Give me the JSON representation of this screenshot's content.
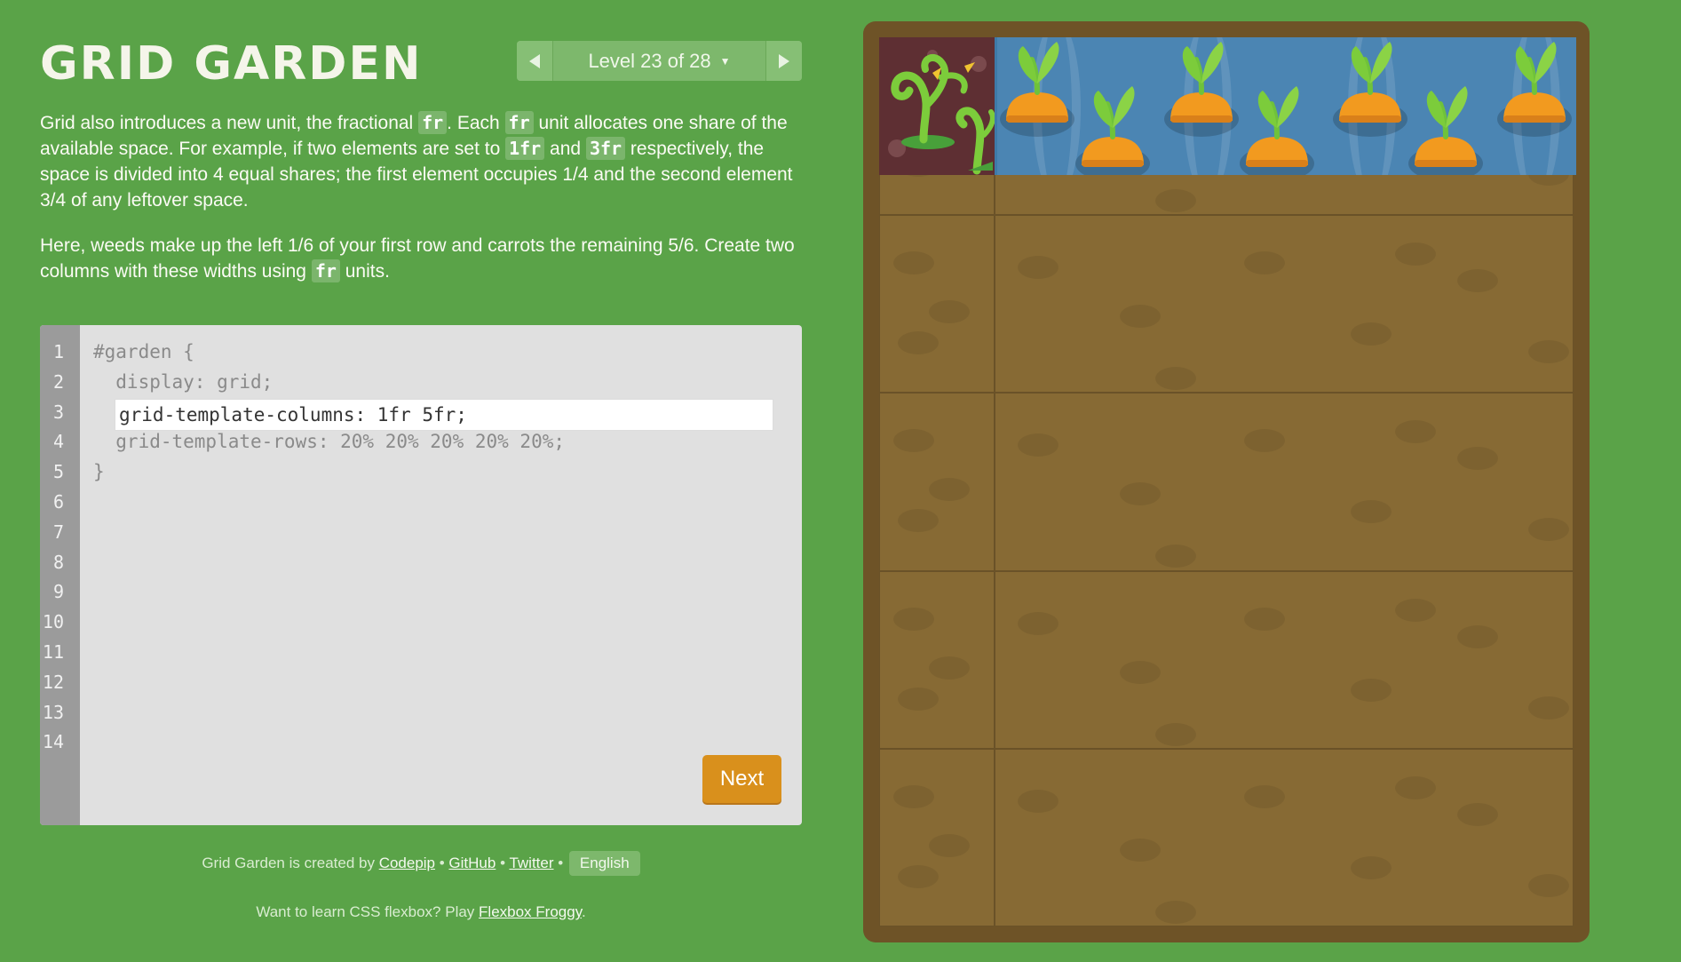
{
  "title": "GRID GARDEN",
  "level": {
    "label": "Level 23 of 28",
    "prev_icon": "triangle-left-icon",
    "next_icon": "triangle-right-icon",
    "caret_icon": "caret-down-icon"
  },
  "instructions": {
    "p1_a": "Grid also introduces a new unit, the fractional ",
    "p1_code1": "fr",
    "p1_b": ". Each ",
    "p1_code2": "fr",
    "p1_c": " unit allocates one share of the available space. For example, if two elements are set to ",
    "p1_code3": "1fr",
    "p1_d": " and ",
    "p1_code4": "3fr",
    "p1_e": " respectively, the space is divided into 4 equal shares; the first element occupies 1/4 and the second element 3/4 of any leftover space.",
    "p2_a": "Here, weeds make up the left 1/6 of your first row and carrots the remaining 5/6. Create two columns with these widths using ",
    "p2_code": "fr",
    "p2_b": " units."
  },
  "editor": {
    "line_numbers": [
      "1",
      "2",
      "3",
      "4",
      "5",
      "6",
      "7",
      "8",
      "9",
      "10",
      "11",
      "12",
      "13",
      "14"
    ],
    "line1": "#garden {",
    "line2": "  display: grid;",
    "input_value": "grid-template-columns: 1fr 5fr;",
    "line4": "  grid-template-rows: 20% 20% 20% 20% 20%;",
    "line5": "}",
    "next_label": "Next"
  },
  "footer": {
    "credits_prefix": "Grid Garden is created by ",
    "link_codepip": "Codepip",
    "sep": " • ",
    "link_github": "GitHub",
    "link_twitter": "Twitter",
    "language": "English",
    "promo_prefix": "Want to learn CSS flexbox? Play ",
    "promo_link": "Flexbox Froggy",
    "promo_suffix": "."
  },
  "colors": {
    "background": "#5aa348",
    "soil": "#876a34",
    "frame": "#6e5327",
    "water": "#4b85b3",
    "weed_bg": "#5e2f33",
    "next_button": "#d9901c"
  }
}
